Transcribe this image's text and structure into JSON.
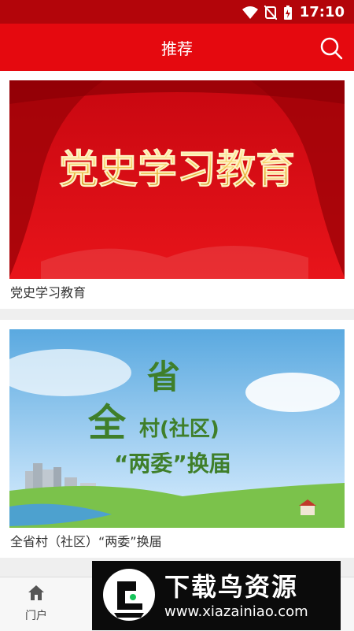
{
  "status_bar": {
    "time": "17:10"
  },
  "app_bar": {
    "title": "推荐",
    "search_icon": "search-icon"
  },
  "feed": [
    {
      "banner_text": "党史学习教育",
      "caption": "党史学习教育"
    },
    {
      "banner_line1": "全",
      "banner_line2": "省",
      "banner_line3": "村(社区)",
      "banner_line4": "“两委”换届",
      "caption": "全省村（社区）“两委”换届"
    }
  ],
  "bottom_nav": {
    "items": [
      {
        "label": "门户",
        "icon": "home-icon"
      }
    ]
  },
  "watermark": {
    "main": "下载鸟资源",
    "url": "www.xiazainiao.com"
  },
  "colors": {
    "primary": "#e5090f",
    "status": "#b3050a"
  }
}
